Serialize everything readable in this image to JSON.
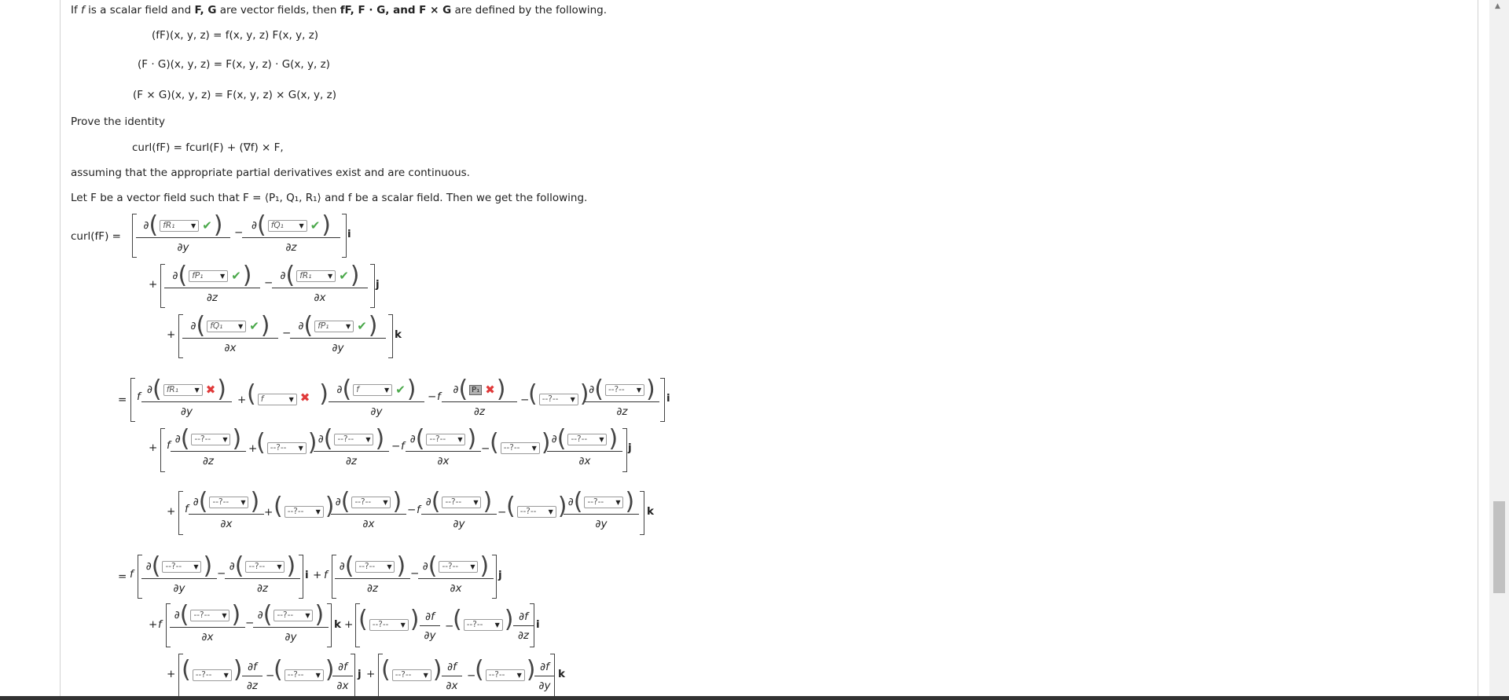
{
  "intro": {
    "line1_a": "If ",
    "line1_f": "f",
    "line1_b": " is a scalar field and ",
    "line1_FG": "F, G",
    "line1_c": " are vector fields, then ",
    "line1_d": "fF, F · G, and F × G",
    "line1_e": " are defined by the following.",
    "def1": "(fF)(x, y, z)  =  f(x, y, z) F(x, y, z)",
    "def2": "(F · G)(x, y, z)  =  F(x, y, z) · G(x, y, z)",
    "def3": "(F × G)(x, y, z)  =  F(x, y, z) × G(x, y, z)",
    "prove": "Prove the identity",
    "identity": "curl(fF)  =  fcurl(F) + (∇f) × F,",
    "assuming": "assuming that the appropriate partial derivatives exist and are continuous.",
    "letF": "Let F be a vector field such that F = ⟨P₁, Q₁, R₁⟩ and f be a scalar field. Then we get the following."
  },
  "labels": {
    "curl_lhs": "curl(fF)  =",
    "d": "∂",
    "dx": "∂x",
    "dy": "∂y",
    "dz": "∂z",
    "df": "∂f",
    "i": "i",
    "j": "j",
    "k": "k",
    "plus": "+",
    "minus": "−",
    "equals": "=",
    "f": "f",
    "placeholder": "--?--"
  },
  "selects": {
    "s1": "fR₁",
    "s2": "fQ₁",
    "s3": "fP₁",
    "s4": "fR₁",
    "s5": "fQ₁",
    "s6": "fP₁",
    "s7": "fR₁",
    "s8": "f",
    "s9": "f",
    "s10": "P₁"
  },
  "colors": {
    "check": "#4aa84a",
    "cross": "#e03a3a"
  }
}
